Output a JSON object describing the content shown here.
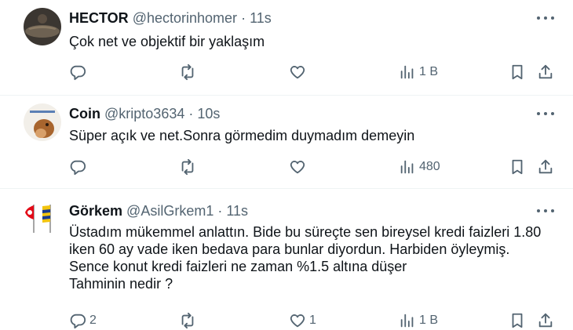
{
  "tweets": [
    {
      "name": "HECTOR",
      "handle": "@hectorinhomer",
      "separator": "·",
      "time": "11s",
      "text": "Çok net ve objektif bir yaklaşım",
      "stats": {
        "replies": "",
        "reposts": "",
        "likes": "",
        "views": "1 B"
      }
    },
    {
      "name": "Coin",
      "handle": "@kripto3634",
      "separator": "·",
      "time": "10s",
      "text": "Süper açık ve net.Sonra görmedim duymadım demeyin",
      "stats": {
        "replies": "",
        "reposts": "",
        "likes": "",
        "views": "480"
      }
    },
    {
      "name": "Görkem",
      "handle": "@AsilGrkem1",
      "separator": "·",
      "time": "11s",
      "text": "Üstadım mükemmel anlattın. Bide bu süreçte sen bireysel kredi faizleri 1.80\niken 60 ay vade iken bedava para bunlar diyordun. Harbiden öyleymiş.\nSence konut kredi faizleri ne zaman %1.5 altına düşer\nTahminin nedir ?",
      "stats": {
        "replies": "2",
        "reposts": "",
        "likes": "1",
        "views": "1 B"
      }
    }
  ],
  "icons": {
    "reply": "reply-icon",
    "repost": "repost-icon",
    "like": "like-icon",
    "views": "views-icon",
    "bookmark": "bookmark-icon",
    "share": "share-icon",
    "more": "more-icon"
  }
}
